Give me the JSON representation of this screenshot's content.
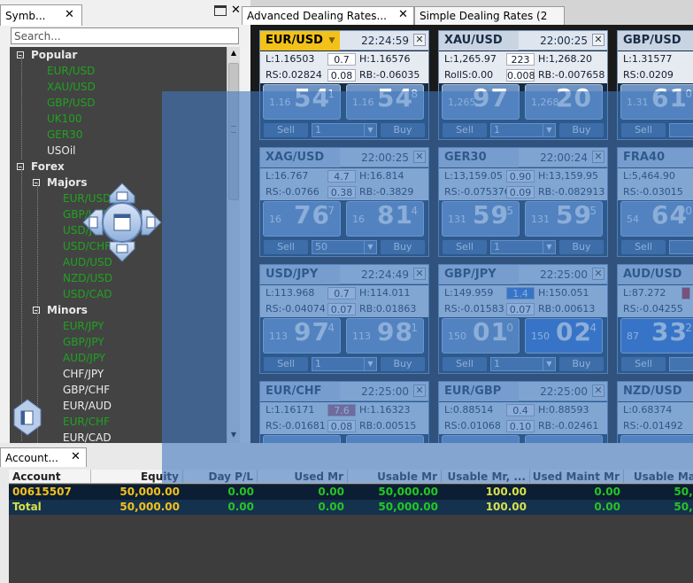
{
  "left_panel": {
    "tab_label": "Symb...",
    "search_placeholder": "Search...",
    "tree": [
      {
        "type": "group",
        "label": "Popular",
        "level": 0
      },
      {
        "type": "item",
        "label": "EUR/USD",
        "color": "green",
        "level": 1
      },
      {
        "type": "item",
        "label": "XAU/USD",
        "color": "green",
        "level": 1
      },
      {
        "type": "item",
        "label": "GBP/USD",
        "color": "green",
        "level": 1
      },
      {
        "type": "item",
        "label": "UK100",
        "color": "green",
        "level": 1
      },
      {
        "type": "item",
        "label": "GER30",
        "color": "green",
        "level": 1
      },
      {
        "type": "item",
        "label": "USOil",
        "color": "white",
        "level": 1
      },
      {
        "type": "group",
        "label": "Forex",
        "level": 0
      },
      {
        "type": "group",
        "label": "Majors",
        "level": 1
      },
      {
        "type": "item",
        "label": "EUR/USD",
        "color": "green",
        "level": 2
      },
      {
        "type": "item",
        "label": "GBP/USD",
        "color": "green",
        "level": 2
      },
      {
        "type": "item",
        "label": "USD/JPY",
        "color": "green",
        "level": 2
      },
      {
        "type": "item",
        "label": "USD/CHF",
        "color": "green",
        "level": 2
      },
      {
        "type": "item",
        "label": "AUD/USD",
        "color": "green",
        "level": 2
      },
      {
        "type": "item",
        "label": "NZD/USD",
        "color": "green",
        "level": 2
      },
      {
        "type": "item",
        "label": "USD/CAD",
        "color": "green",
        "level": 2
      },
      {
        "type": "group",
        "label": "Minors",
        "level": 1
      },
      {
        "type": "item",
        "label": "EUR/JPY",
        "color": "green",
        "level": 2
      },
      {
        "type": "item",
        "label": "GBP/JPY",
        "color": "green",
        "level": 2
      },
      {
        "type": "item",
        "label": "AUD/JPY",
        "color": "green",
        "level": 2
      },
      {
        "type": "item",
        "label": "CHF/JPY",
        "color": "white",
        "level": 2
      },
      {
        "type": "item",
        "label": "GBP/CHF",
        "color": "white",
        "level": 2
      },
      {
        "type": "item",
        "label": "EUR/AUD",
        "color": "white",
        "level": 2
      },
      {
        "type": "item",
        "label": "EUR/CHF",
        "color": "green",
        "level": 2
      },
      {
        "type": "item",
        "label": "EUR/CAD",
        "color": "white",
        "level": 2
      }
    ]
  },
  "right_panel": {
    "tabs": [
      {
        "label": "Advanced Dealing Rates...",
        "active": true
      },
      {
        "label": "Simple Dealing Rates (2",
        "active": false
      }
    ],
    "tiles": [
      {
        "symbol": "EUR/USD",
        "active": true,
        "time": "22:24:59",
        "row1": [
          "L:1.16503",
          "0.7",
          "H:1.16576"
        ],
        "row2": [
          "RS:0.02824",
          "0.08",
          "RB:-0.06035"
        ],
        "sell": {
          "small": "1.16",
          "big": "54",
          "sup": "1"
        },
        "buy": {
          "small": "1.16",
          "big": "54",
          "sup": "8"
        },
        "qty": "1",
        "hl_buy": false,
        "hl_sell": false
      },
      {
        "symbol": "XAU/USD",
        "active": false,
        "time": "22:00:25",
        "row1": [
          "L:1,265.97",
          "223",
          "H:1,268.20"
        ],
        "row2": [
          "RollS:0.00",
          "0.008",
          "RB:-0.007658"
        ],
        "sell": {
          "small": "1,265",
          "big": "97",
          "sup": ""
        },
        "buy": {
          "small": "1,268",
          "big": "20",
          "sup": ""
        },
        "qty": "1",
        "hl_buy": false,
        "hl_sell": false
      },
      {
        "symbol": "GBP/USD",
        "active": false,
        "time": "",
        "row1": [
          "L:1.31577",
          "",
          ""
        ],
        "row2": [
          "RS:0.0209",
          "",
          ""
        ],
        "sell": {
          "small": "1.31",
          "big": "61",
          "sup": "0"
        },
        "buy": {
          "small": "",
          "big": "",
          "sup": ""
        },
        "qty": "",
        "hl_buy": false,
        "hl_sell": false
      },
      {
        "symbol": "XAG/USD",
        "active": false,
        "time": "22:00:25",
        "row1": [
          "L:16.767",
          "4.7",
          "H:16.814"
        ],
        "row2": [
          "RS:-0.0766",
          "0.38",
          "RB:-0.3829"
        ],
        "sell": {
          "small": "16",
          "big": "76",
          "sup": "7"
        },
        "buy": {
          "small": "16",
          "big": "81",
          "sup": "4"
        },
        "qty": "50",
        "hl_buy": false,
        "hl_sell": false
      },
      {
        "symbol": "GER30",
        "active": false,
        "time": "22:00:24",
        "row1": [
          "L:13,159.05",
          "0.90",
          "H:13,159.95"
        ],
        "row2": [
          "RS:-0.075376",
          "0.09",
          "RB:-0.082913"
        ],
        "sell": {
          "small": "131",
          "big": "59",
          "sup": "05"
        },
        "buy": {
          "small": "131",
          "big": "59",
          "sup": "95"
        },
        "qty": "1",
        "hl_buy": false,
        "hl_sell": false
      },
      {
        "symbol": "FRA40",
        "active": false,
        "time": "",
        "row1": [
          "L:5,464.90",
          "",
          ""
        ],
        "row2": [
          "RS:-0.03015",
          "",
          ""
        ],
        "sell": {
          "small": "54",
          "big": "64",
          "sup": "90"
        },
        "buy": {
          "small": "",
          "big": "",
          "sup": ""
        },
        "qty": "",
        "hl_buy": false,
        "hl_sell": false
      },
      {
        "symbol": "USD/JPY",
        "active": false,
        "time": "22:24:49",
        "row1": [
          "L:113.968",
          "0.7",
          "H:114.011"
        ],
        "row2": [
          "RS:-0.04074",
          "0.07",
          "RB:0.01863"
        ],
        "sell": {
          "small": "113",
          "big": "97",
          "sup": "4"
        },
        "buy": {
          "small": "113",
          "big": "98",
          "sup": "1"
        },
        "qty": "1",
        "hl_buy": false,
        "hl_sell": false
      },
      {
        "symbol": "GBP/JPY",
        "active": false,
        "time": "22:25:00",
        "row1": [
          "L:149.959",
          "1.4",
          "H:150.051"
        ],
        "row2": [
          "RS:-0.01583",
          "0.07",
          "RB:0.00613"
        ],
        "sell": {
          "small": "150",
          "big": "01",
          "sup": "0"
        },
        "buy": {
          "small": "150",
          "big": "02",
          "sup": "4"
        },
        "qty": "1",
        "hl_buy": true,
        "hl_sell": false
      },
      {
        "symbol": "AUD/USD",
        "active": false,
        "time": "",
        "row1": [
          "L:87.272",
          "",
          ""
        ],
        "row2": [
          "RS:-0.04255",
          "",
          ""
        ],
        "sell": {
          "small": "87",
          "big": "33",
          "sup": "2"
        },
        "buy": {
          "small": "",
          "big": "",
          "sup": ""
        },
        "qty": "",
        "hl_buy": false,
        "hl_sell": true
      },
      {
        "symbol": "EUR/CHF",
        "active": false,
        "time": "22:25:00",
        "row1": [
          "L:1.16171",
          "7.6",
          "H:1.16323"
        ],
        "row2": [
          "RS:-0.01681",
          "0.08",
          "RB:0.00515"
        ],
        "sell": {
          "small": "",
          "big": "",
          "sup": ""
        },
        "buy": {
          "small": "",
          "big": "",
          "sup": ""
        },
        "qty": "",
        "hl_buy": false,
        "hl_sell": false
      },
      {
        "symbol": "EUR/GBP",
        "active": false,
        "time": "22:25:00",
        "row1": [
          "L:0.88514",
          "0.4",
          "H:0.88593"
        ],
        "row2": [
          "RS:0.01068",
          "0.10",
          "RB:-0.02461"
        ],
        "sell": {
          "small": "",
          "big": "",
          "sup": ""
        },
        "buy": {
          "small": "",
          "big": "",
          "sup": ""
        },
        "qty": "",
        "hl_buy": false,
        "hl_sell": false
      },
      {
        "symbol": "NZD/USD",
        "active": false,
        "time": "",
        "row1": [
          "L:0.68374",
          "",
          ""
        ],
        "row2": [
          "RS:-0.01492",
          "",
          ""
        ],
        "sell": {
          "small": "",
          "big": "",
          "sup": ""
        },
        "buy": {
          "small": "",
          "big": "",
          "sup": ""
        },
        "qty": "",
        "hl_buy": false,
        "hl_sell": false
      }
    ],
    "sell_label": "Sell",
    "buy_label": "Buy"
  },
  "bottom_panel": {
    "tab_label": "Account...",
    "columns": [
      "Account",
      "Equity",
      "Day P/L",
      "Used Mr",
      "Usable Mr",
      "Usable Mr, ...",
      "Used Maint Mr",
      "Usable Mai"
    ],
    "rows": [
      {
        "cells": [
          "00615507",
          "50,000.00",
          "0.00",
          "0.00",
          "50,000.00",
          "100.00",
          "0.00",
          "50,0"
        ],
        "type": "account"
      },
      {
        "cells": [
          "Total",
          "50,000.00",
          "0.00",
          "0.00",
          "50,000.00",
          "100.00",
          "0.00",
          "50,0"
        ],
        "type": "total"
      }
    ]
  },
  "colors": {
    "accent": "#f2c21a",
    "green": "#1fa31f",
    "tile_bg": "#162b44"
  }
}
